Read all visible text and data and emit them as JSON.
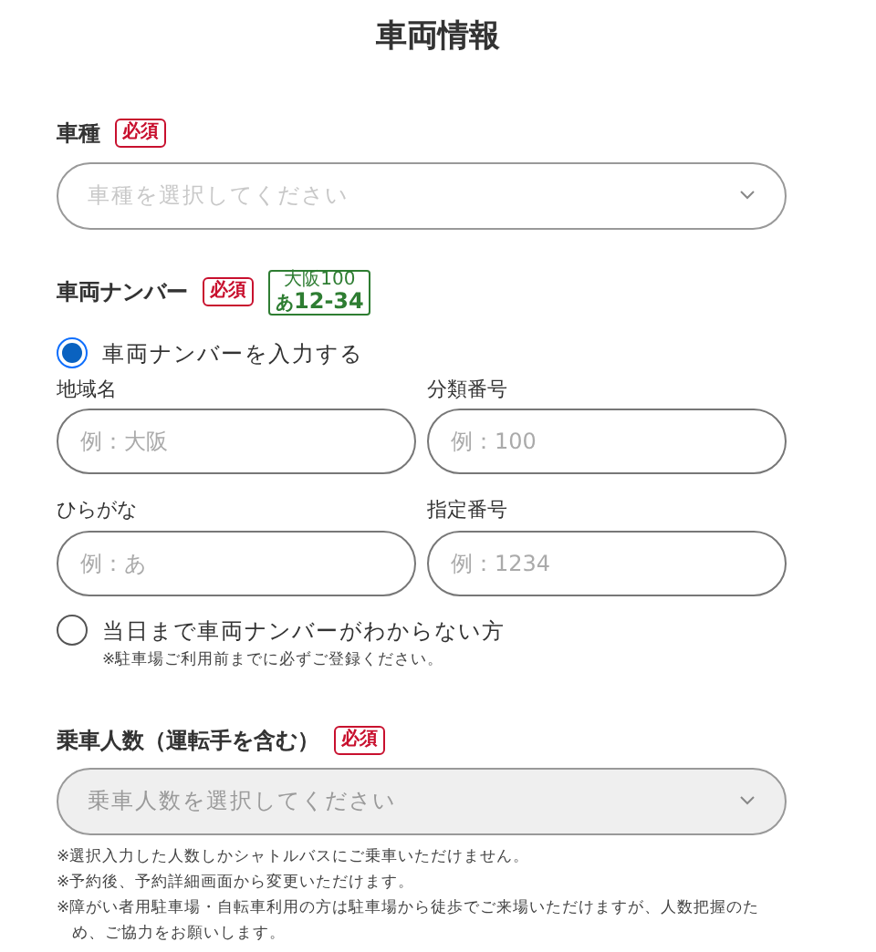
{
  "title": "車両情報",
  "car_type": {
    "label": "車種",
    "required": "必須",
    "placeholder": "車種を選択してください",
    "disabled": false
  },
  "plate": {
    "label": "車両ナンバー",
    "required": "必須",
    "sample_top": "大阪100",
    "sample_kana": "あ",
    "sample_number": "12-34"
  },
  "options": [
    {
      "label": "車両ナンバーを入力する",
      "selected": true,
      "fields": [
        {
          "label": "地域名",
          "placeholder": "例：大阪"
        },
        {
          "label": "分類番号",
          "placeholder": "例：100"
        },
        {
          "label": "ひらがな",
          "placeholder": "例：あ"
        },
        {
          "label": "指定番号",
          "placeholder": "例：1234"
        }
      ]
    },
    {
      "label": "当日まで車両ナンバーがわからない方",
      "selected": false,
      "note": "※駐車場ご利用前までに必ずご登録ください。"
    }
  ],
  "passengers": {
    "label": "乗車人数（運転手を含む）",
    "required": "必須",
    "placeholder": "乗車人数を選択してください",
    "disabled": true,
    "notes": [
      "※選択入力した人数しかシャトルバスにご乗車いただけません。",
      "※予約後、予約詳細画面から変更いただけます。",
      "※障がい者用駐車場・自転車利用の方は駐車場から徒歩でご来場いただけますが、人数把握のため、ご協力をお願いします。"
    ]
  }
}
